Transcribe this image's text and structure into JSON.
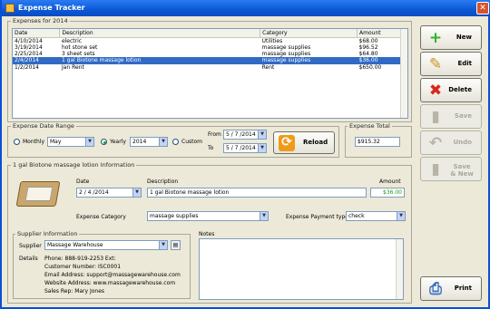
{
  "window": {
    "title": "Expense Tracker"
  },
  "expenses_panel": {
    "legend": "Expenses for 2014"
  },
  "table": {
    "columns": [
      "Date",
      "Description",
      "Category",
      "Amount"
    ],
    "rows": [
      {
        "date": "4/10/2014",
        "description": "electric",
        "category": "Utilities",
        "amount": "$68.00"
      },
      {
        "date": "3/19/2014",
        "description": "hot stone set",
        "category": "massage supplies",
        "amount": "$96.52"
      },
      {
        "date": "2/25/2014",
        "description": "3 sheet sets",
        "category": "massage supplies",
        "amount": "$64.80"
      },
      {
        "date": "2/4/2014",
        "description": "1 gal Biotone massage lotion",
        "category": "massage supplies",
        "amount": "$36.00"
      },
      {
        "date": "1/2/2014",
        "description": "Jan Rent",
        "category": "Rent",
        "amount": "$650.00"
      }
    ]
  },
  "date_range": {
    "legend": "Expense Date Range",
    "monthly_label": "Monthly",
    "month_value": "May",
    "yearly_label": "Yearly",
    "year_value": "2014",
    "custom_label": "Custom",
    "from_label": "From",
    "from_value": "5 / 7 /2014",
    "to_label": "To",
    "to_value": "5 / 7 /2014",
    "reload_label": "Reload",
    "selected": "yearly"
  },
  "total": {
    "legend": "Expense Total",
    "value": "$915.32"
  },
  "buttons": {
    "new": "New",
    "edit": "Edit",
    "delete": "Delete",
    "save": "Save",
    "undo": "Undo",
    "save_new_1": "Save",
    "save_new_2": "& New",
    "print": "Print"
  },
  "detail": {
    "legend": "1 gal Biotone massage lotion Information",
    "date_label": "Date",
    "date_value": "2 / 4 /2014",
    "description_label": "Description",
    "description_value": "1 gal Biotone massage lotion",
    "amount_label": "Amount",
    "amount_value": "$36.00",
    "category_label": "Expense Category",
    "category_value": "massage supplies",
    "payment_label": "Expense Payment type",
    "payment_value": "check"
  },
  "supplier": {
    "legend": "Supplier Information",
    "supplier_label": "Supplier",
    "supplier_value": "Massage Warehouse",
    "details_label": "Details",
    "phone": "Phone: 888-919-2253  Ext:",
    "customer": "Customer Number: ISC0001",
    "email": "Email Address: support@massagewarehouse.com",
    "website": "Website Address: www.massagewarehouse.com",
    "rep": "Sales Rep: Mary Jones"
  },
  "notes": {
    "legend": "Notes"
  }
}
